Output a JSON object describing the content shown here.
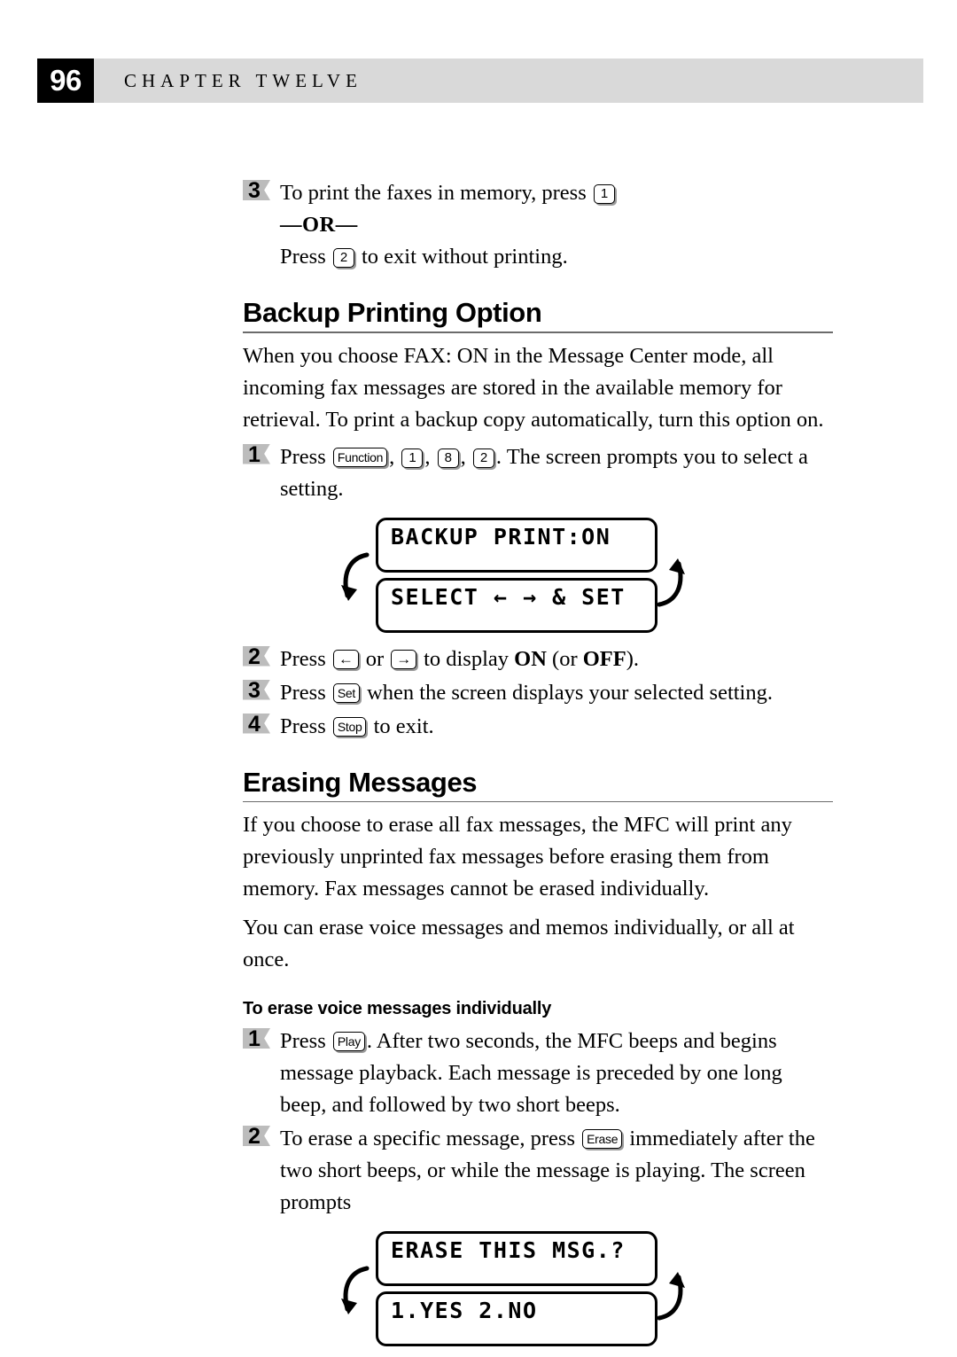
{
  "header": {
    "page_number": "96",
    "chapter_title": "CHAPTER TWELVE"
  },
  "steps_top": [
    {
      "number": "3",
      "text_before": "To print the faxes in memory, press",
      "key": "1",
      "or_label": "—OR—",
      "text_after_before_key": "Press",
      "key2": "2",
      "text_after": "to exit without printing."
    }
  ],
  "section_backup": {
    "heading": "Backup Printing Option",
    "paragraph": "When you choose FAX: ON in the Message Center mode, all incoming fax messages are stored in the available memory for retrieval. To print a backup copy automatically, turn this option on.",
    "step1": {
      "number": "1",
      "press_label": "Press",
      "key_function": "Function",
      "key_1": "1",
      "key_8": "8",
      "key_2": "2",
      "tail": ". The screen prompts you to select a setting.",
      "comma1": ",",
      "comma2": ",",
      "comma3": ","
    },
    "lcd": {
      "line1": "BACKUP PRINT:ON",
      "line2": "SELECT ← → & SET"
    },
    "step2": {
      "number": "2",
      "press_label": "Press",
      "key_left": "←",
      "or_label": "or",
      "key_right": "→",
      "mid": "to display",
      "on_label": "ON",
      "paren_open": "(or",
      "off_label": "OFF",
      "paren_close": ")."
    },
    "step3": {
      "number": "3",
      "press_label": "Press",
      "key_set": "Set",
      "tail": "when the screen displays your selected setting."
    },
    "step4": {
      "number": "4",
      "press_label": "Press",
      "key_stop": "Stop",
      "tail": "to exit."
    }
  },
  "section_erasing": {
    "heading": "Erasing Messages",
    "paragraph1": "If you choose to erase all fax messages, the MFC will print any previously unprinted fax messages before erasing them from memory. Fax messages cannot be erased individually.",
    "paragraph2": "You can erase voice messages and memos individually, or all at once.",
    "subheading": "To erase voice messages individually",
    "step1": {
      "number": "1",
      "press_label": "Press",
      "key_play": "Play",
      "tail": ". After two seconds, the MFC beeps and begins message playback. Each message is preceded by one long beep, and followed by two short beeps."
    },
    "step2": {
      "number": "2",
      "text_before": "To erase a specific message, press",
      "key_erase": "Erase",
      "tail": "immediately after the two short beeps, or while the message is playing. The screen prompts"
    },
    "lcd": {
      "line1": "ERASE THIS MSG.?",
      "line2": "1.YES 2.NO"
    }
  },
  "colors": {
    "header_bar": "#d9d9d9",
    "page_box": "#000000",
    "rule": "#6b6b6b",
    "step_flag": "#bcbcbc"
  }
}
